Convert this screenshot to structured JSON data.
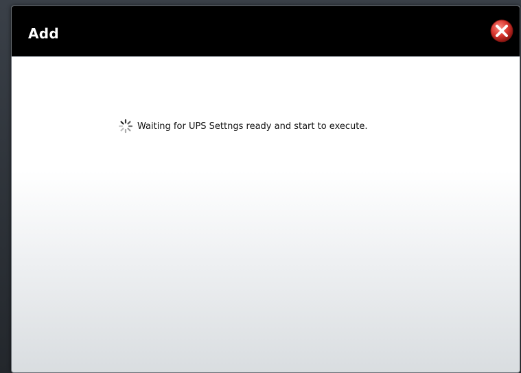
{
  "dialog": {
    "title": "Add",
    "message": "Waiting for UPS Settngs ready and start to execute."
  },
  "icons": {
    "close": "close-icon",
    "spinner": "loading-spinner-icon"
  },
  "colors": {
    "titlebar": "#000000",
    "close_button": "#d6342d"
  }
}
